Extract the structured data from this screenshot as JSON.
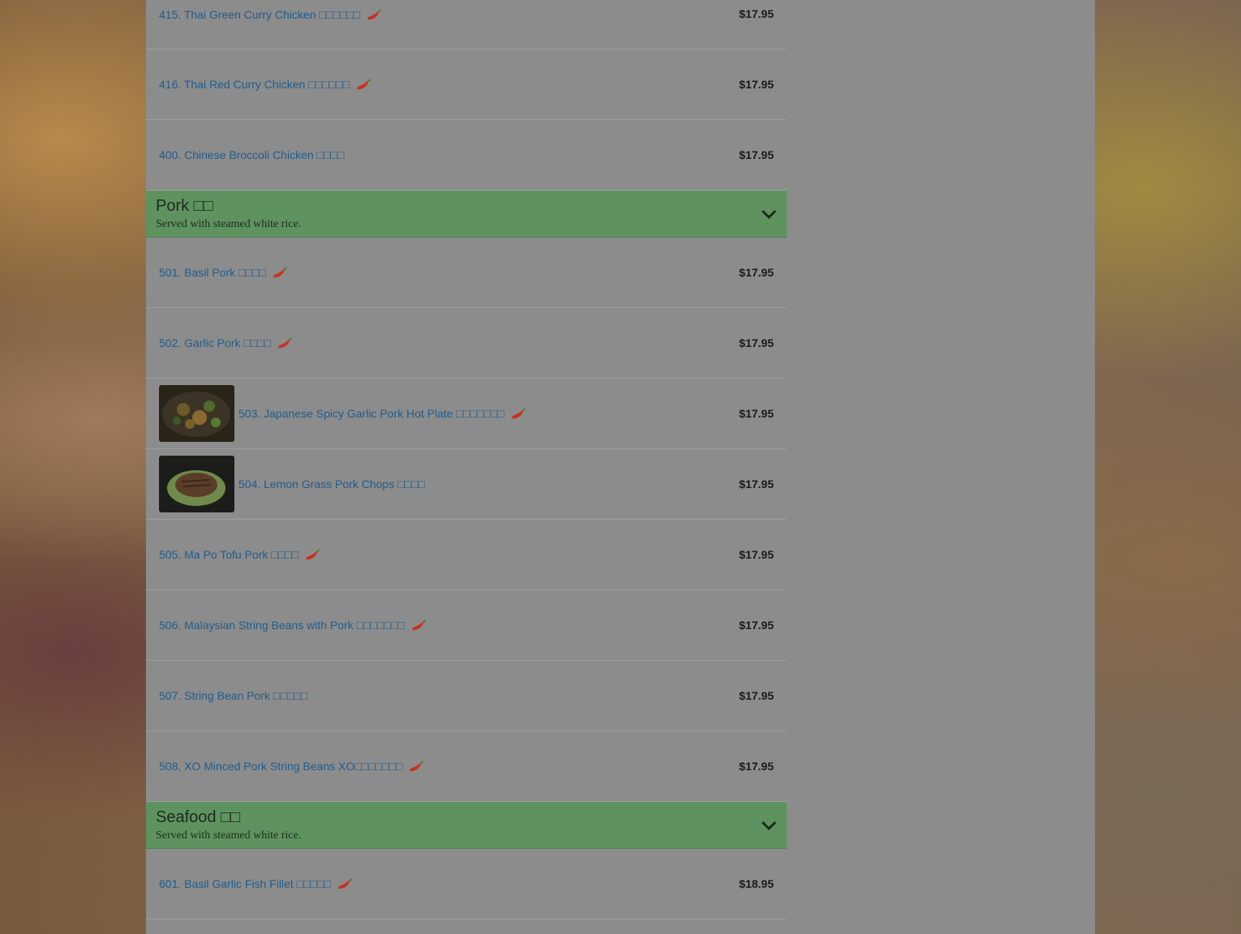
{
  "background_color": "#8c8c8c",
  "accent_green": "#5e9360",
  "link_color": "#1f5d8c",
  "rows_top": [
    {
      "label": "415. Thai Green Curry Chicken □□□□□□",
      "price": "$17.95",
      "spicy": true
    },
    {
      "label": "416. Thai Red Curry Chicken □□□□□□",
      "price": "$17.95",
      "spicy": true
    },
    {
      "label": "400. Chinese Broccoli Chicken □□□□",
      "price": "$17.95",
      "spicy": false
    }
  ],
  "pork": {
    "title": "Pork □□",
    "subtitle": "Served with steamed white rice.",
    "items": [
      {
        "label": "501. Basil Pork □□□□",
        "price": "$17.95",
        "spicy": true
      },
      {
        "label": "502. Garlic Pork □□□□",
        "price": "$17.95",
        "spicy": true
      },
      {
        "label": "503. Japanese Spicy Garlic Pork Hot Plate □□□□□□□",
        "price": "$17.95",
        "spicy": true,
        "image": "pork-hot-plate-photo"
      },
      {
        "label": "504. Lemon Grass Pork Chops □□□□",
        "price": "$17.95",
        "spicy": false,
        "image": "pork-chops-photo"
      },
      {
        "label": "505. Ma Po Tofu Pork □□□□",
        "price": "$17.95",
        "spicy": true
      },
      {
        "label": "506. Malaysian String Beans with Pork □□□□□□□",
        "price": "$17.95",
        "spicy": true
      },
      {
        "label": "507. String Bean Pork □□□□□",
        "price": "$17.95",
        "spicy": false
      },
      {
        "label": "508. XO Minced Pork String Beans XO□□□□□□□",
        "price": "$17.95",
        "spicy": true
      }
    ]
  },
  "seafood": {
    "title": "Seafood □□",
    "subtitle": "Served with steamed white rice.",
    "items": [
      {
        "label": "601. Basil Garlic Fish Fillet □□□□□",
        "price": "$18.95",
        "spicy": true
      }
    ]
  },
  "icons": {
    "spicy": "chili-pepper-icon",
    "expand": "chevron-down-icon"
  }
}
